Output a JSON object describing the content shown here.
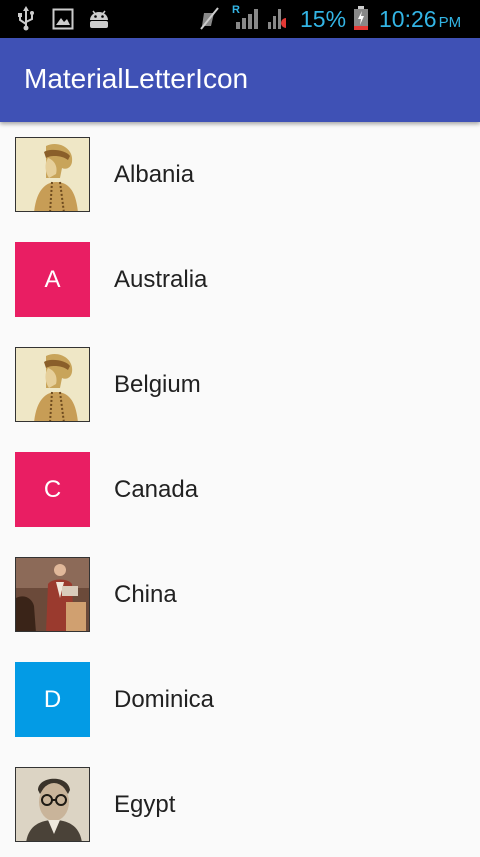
{
  "status_bar": {
    "battery_percent": "15%",
    "time": "10:26",
    "ampm": "PM",
    "roaming": "R",
    "icons": [
      "usb-icon",
      "image-icon",
      "android-icon",
      "mute-icon",
      "signal-icon",
      "battery-icon"
    ]
  },
  "app_bar": {
    "title": "MaterialLetterIcon"
  },
  "colors": {
    "status_text": "#33b5e5",
    "app_bar": "#3f51b5",
    "pink": "#e91e63",
    "blue": "#039be5"
  },
  "list": {
    "items": [
      {
        "name": "Albania",
        "icon": "photo-vintage-woman"
      },
      {
        "name": "Australia",
        "icon": "letter",
        "letter": "A",
        "color": "#e91e63"
      },
      {
        "name": "Belgium",
        "icon": "photo-vintage-woman"
      },
      {
        "name": "Canada",
        "icon": "letter",
        "letter": "C",
        "color": "#e91e63"
      },
      {
        "name": "China",
        "icon": "photo-man-red"
      },
      {
        "name": "Dominica",
        "icon": "letter",
        "letter": "D",
        "color": "#039be5"
      },
      {
        "name": "Egypt",
        "icon": "photo-man-glasses"
      }
    ]
  }
}
